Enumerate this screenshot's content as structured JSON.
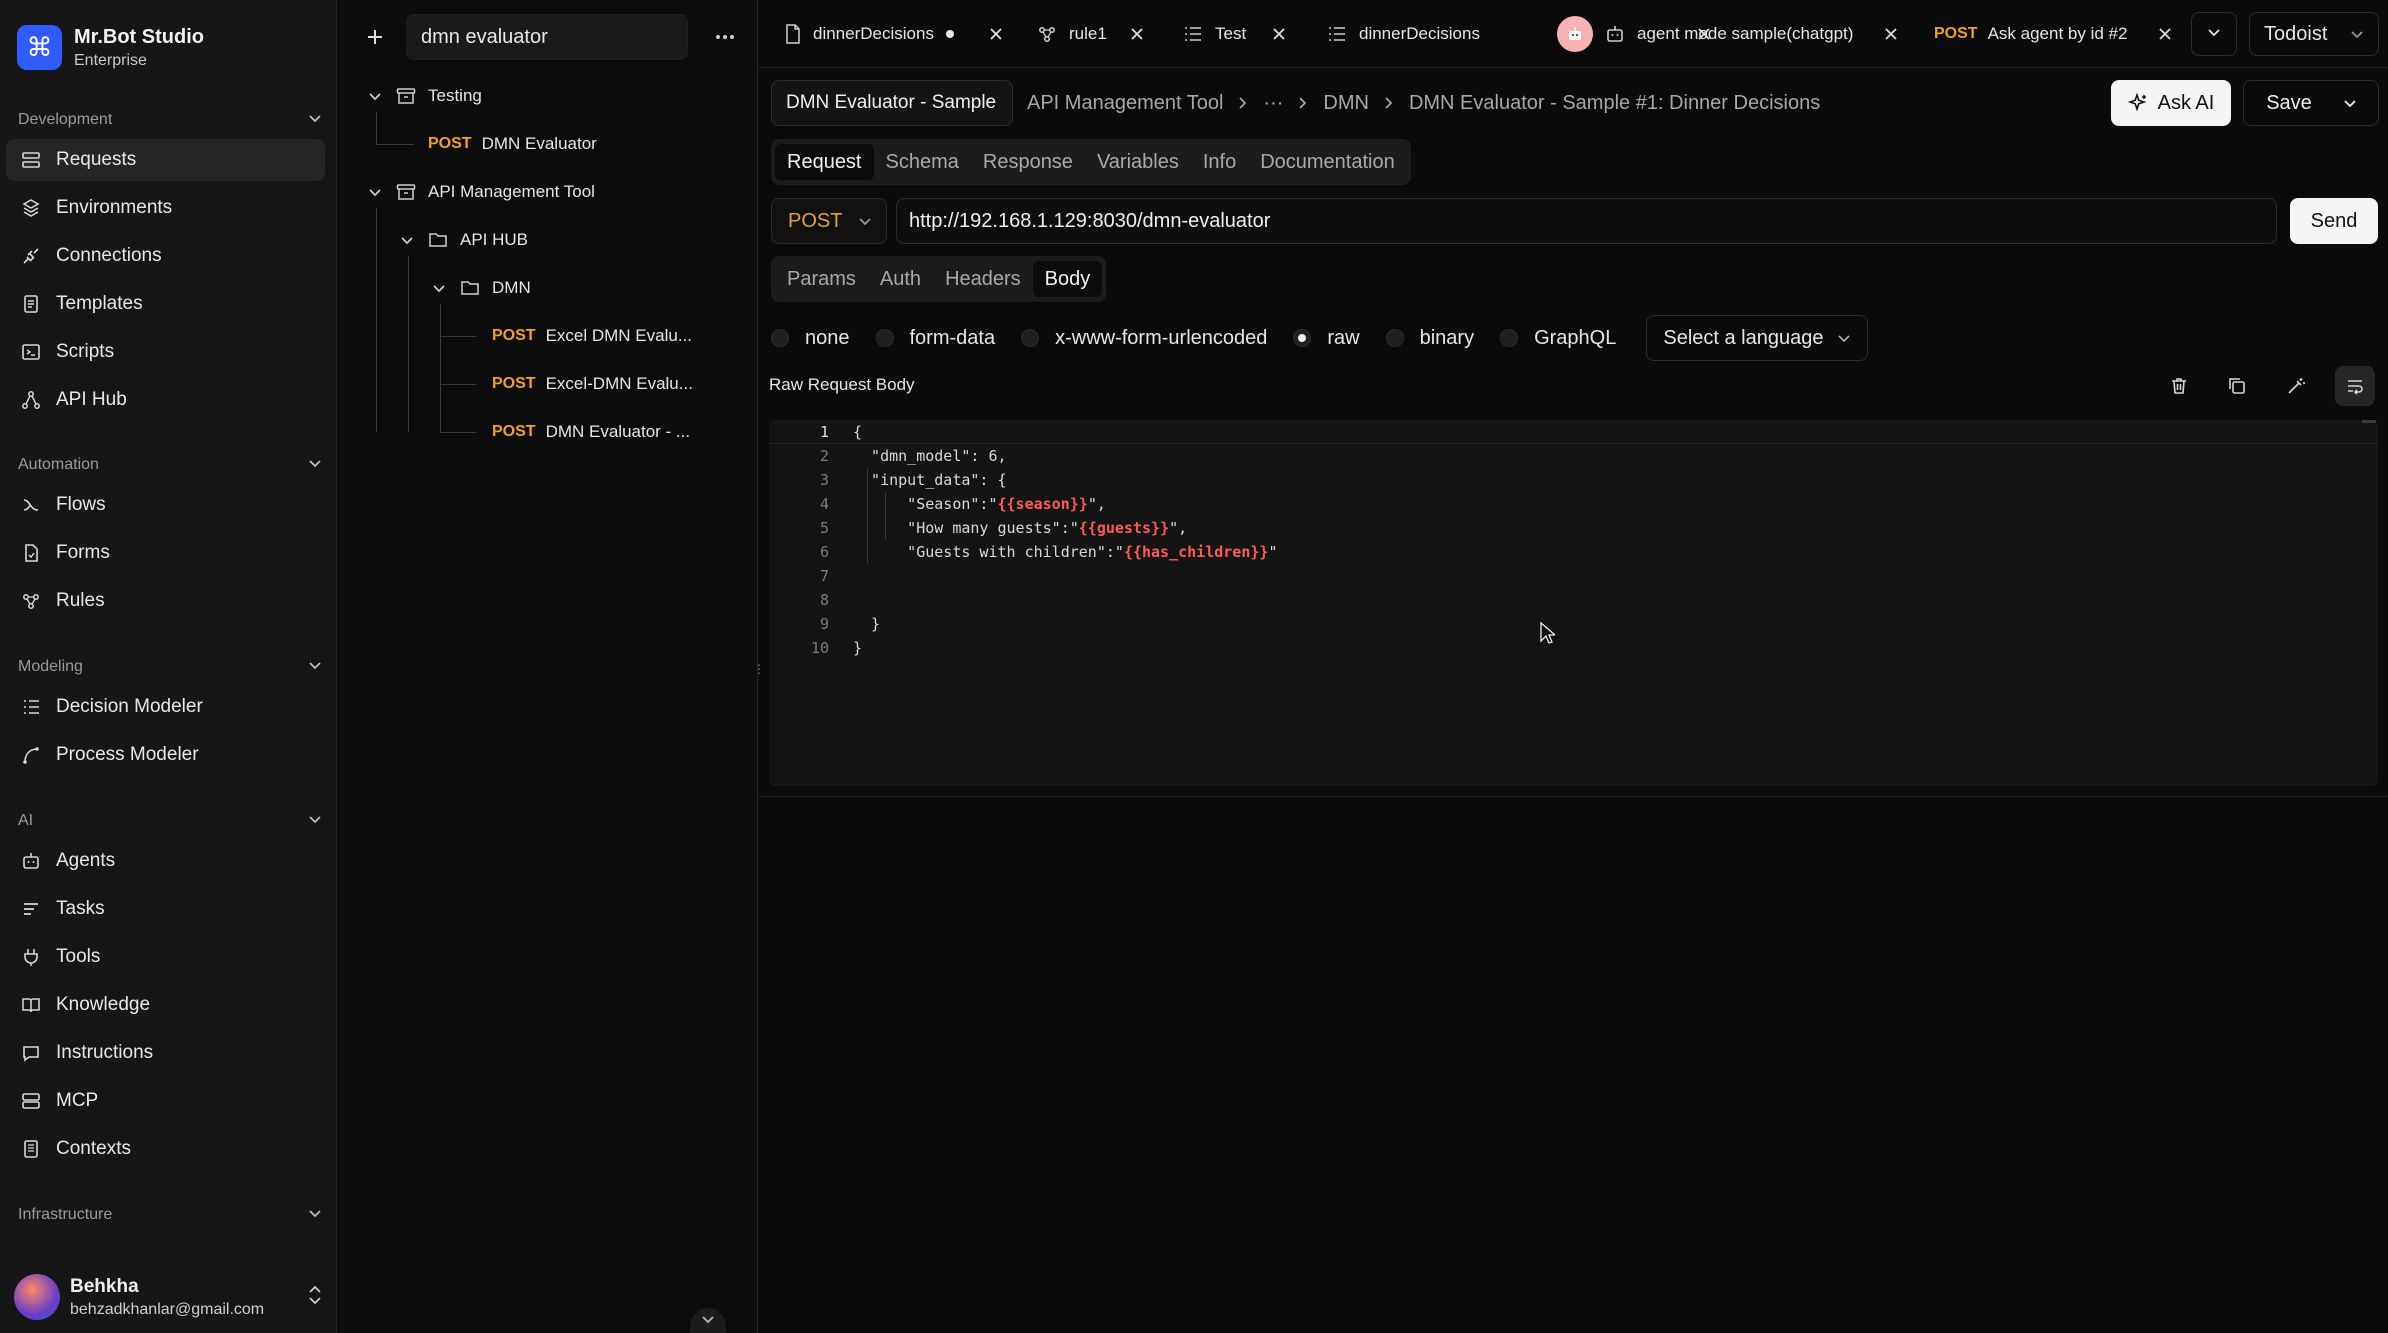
{
  "brand": {
    "name": "Mr.Bot Studio",
    "plan": "Enterprise"
  },
  "sidebar": {
    "groups": [
      {
        "title": "Development",
        "items": [
          {
            "label": "Requests",
            "icon": "requests-icon",
            "active": true
          },
          {
            "label": "Environments",
            "icon": "environments-icon"
          },
          {
            "label": "Connections",
            "icon": "connections-icon"
          },
          {
            "label": "Templates",
            "icon": "templates-icon"
          },
          {
            "label": "Scripts",
            "icon": "scripts-icon"
          },
          {
            "label": "API Hub",
            "icon": "api-hub-icon"
          }
        ]
      },
      {
        "title": "Automation",
        "items": [
          {
            "label": "Flows",
            "icon": "flows-icon"
          },
          {
            "label": "Forms",
            "icon": "forms-icon"
          },
          {
            "label": "Rules",
            "icon": "rules-icon"
          }
        ]
      },
      {
        "title": "Modeling",
        "items": [
          {
            "label": "Decision Modeler",
            "icon": "decision-modeler-icon"
          },
          {
            "label": "Process Modeler",
            "icon": "process-modeler-icon"
          }
        ]
      },
      {
        "title": "AI",
        "items": [
          {
            "label": "Agents",
            "icon": "agents-icon"
          },
          {
            "label": "Tasks",
            "icon": "tasks-icon"
          },
          {
            "label": "Tools",
            "icon": "tools-icon"
          },
          {
            "label": "Knowledge",
            "icon": "knowledge-icon"
          },
          {
            "label": "Instructions",
            "icon": "instructions-icon"
          },
          {
            "label": "MCP",
            "icon": "mcp-icon"
          },
          {
            "label": "Contexts",
            "icon": "contexts-icon"
          }
        ]
      },
      {
        "title": "Infrastructure",
        "items": []
      }
    ]
  },
  "user": {
    "name": "Behkha",
    "email": "behzadkhanlar@gmail.com"
  },
  "tree": {
    "search_value": "dmn evaluator",
    "nodes": [
      {
        "label": "Testing",
        "kind": "collection"
      },
      {
        "label": "DMN Evaluator",
        "kind": "request",
        "method": "POST"
      },
      {
        "label": "API Management Tool",
        "kind": "collection"
      },
      {
        "label": "API HUB",
        "kind": "folder"
      },
      {
        "label": "DMN",
        "kind": "folder"
      },
      {
        "label": "Excel DMN Evalu...",
        "kind": "request",
        "method": "POST"
      },
      {
        "label": "Excel-DMN Evalu...",
        "kind": "request",
        "method": "POST"
      },
      {
        "label": "DMN Evaluator - ...",
        "kind": "request",
        "method": "POST"
      }
    ]
  },
  "tabs": [
    {
      "label": "dinnerDecisions",
      "icon": "file-icon",
      "unsaved": true
    },
    {
      "label": "rule1",
      "icon": "rules-icon"
    },
    {
      "label": "Test",
      "icon": "list-icon"
    },
    {
      "label": "dinnerDecisions",
      "icon": "decision-list-icon"
    },
    {
      "label": "agent mode sample(chatgpt)",
      "icon": "agent-icon"
    },
    {
      "label": "Ask agent by id #2",
      "method": "POST"
    }
  ],
  "workspace": {
    "selected": "Todoist"
  },
  "request": {
    "name_value": "DMN Evaluator - Sample #1: Dinner Decisions",
    "breadcrumbs": [
      "API Management Tool",
      "···",
      "DMN",
      "DMN Evaluator - Sample #1: Dinner Decisions"
    ],
    "ask_ai_label": "Ask AI",
    "save_label": "Save",
    "top_tabs": [
      "Request",
      "Schema",
      "Response",
      "Variables",
      "Info",
      "Documentation"
    ],
    "top_tab_active": "Request",
    "method": "POST",
    "url": "http://192.168.1.129:8030/dmn-evaluator",
    "send_label": "Send",
    "sub_tabs": [
      "Params",
      "Auth",
      "Headers",
      "Body"
    ],
    "sub_tab_active": "Body",
    "body_types": [
      "none",
      "form-data",
      "x-www-form-urlencoded",
      "raw",
      "binary",
      "GraphQL"
    ],
    "body_type_selected": "raw",
    "language_placeholder": "Select a language",
    "raw_label": "Raw Request Body"
  },
  "editor": {
    "lines": [
      "{",
      "  \"dmn_model\": 6,",
      "  \"input_data\": {",
      "      \"Season\":\"{{season}}\",",
      "      \"How many guests\":\"{{guests}}\",",
      "      \"Guests with children\":\"{{has_children}}\"",
      "",
      "",
      "  }",
      "}"
    ],
    "line_numbers": [
      "1",
      "2",
      "3",
      "4",
      "5",
      "6",
      "7",
      "8",
      "9",
      "10"
    ]
  },
  "colors": {
    "accent": "#2f5bff",
    "method_post": "#f0a02c",
    "template_var": "#ff5a5a"
  }
}
